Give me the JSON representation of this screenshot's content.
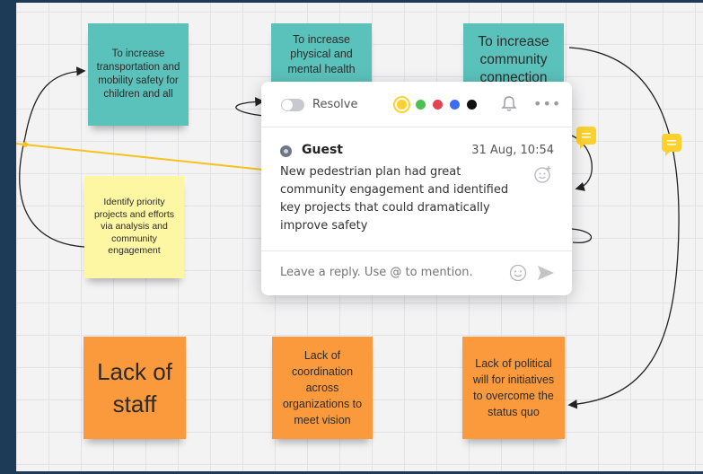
{
  "stickies": {
    "transport": "To increase transportation and mobility safety for children and all",
    "health": "To increase physical and mental health",
    "community": "To increase community connection",
    "identify": "Identify priority projects and efforts via analysis and community engagement",
    "staff": "Lack of staff",
    "coordination": "Lack of coordination across organizations to meet vision",
    "political": "Lack of political will for initiatives to overcome the status quo"
  },
  "comment": {
    "resolve_label": "Resolve",
    "author": "Guest",
    "time": "31 Aug, 10:54",
    "text": "New pedestrian plan had great community engagement and identified key projects that could dramatically improve safety",
    "reply_placeholder": "Leave a reply. Use @ to mention.",
    "colors": [
      "#fcd02d",
      "#49c24f",
      "#e24450",
      "#3b6cf2",
      "#111111"
    ]
  },
  "icons": [
    "toggle-icon",
    "bell-icon",
    "more-icon",
    "add-reaction-icon",
    "emoji-icon",
    "send-icon",
    "comment-badge-icon"
  ]
}
